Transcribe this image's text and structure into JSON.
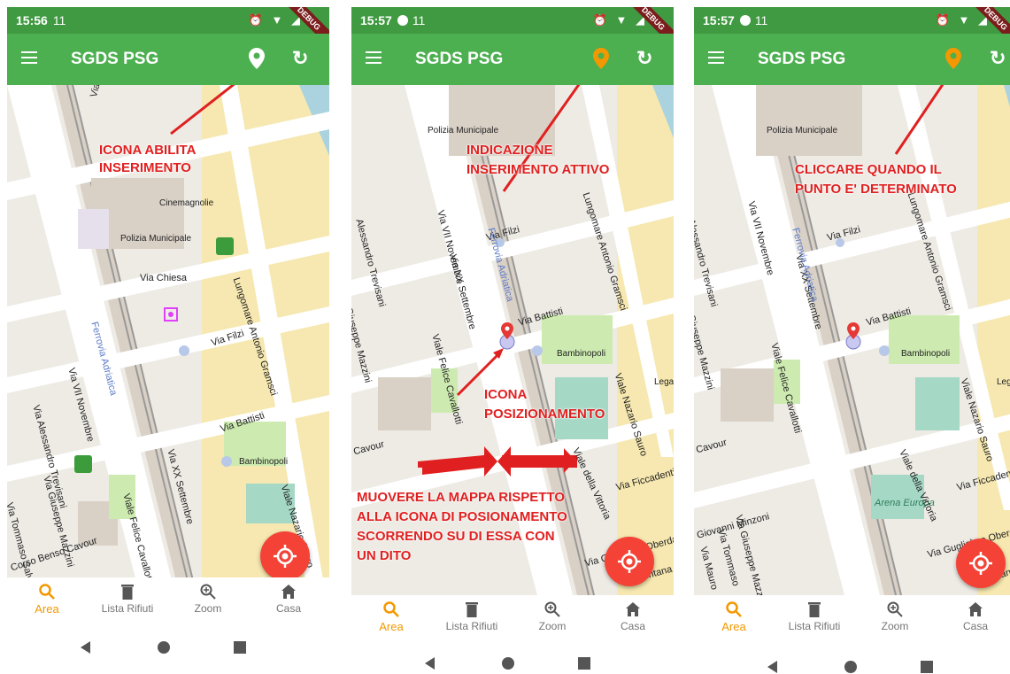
{
  "colors": {
    "appbar": "#4caf50",
    "statusbar": "#3f9a41",
    "accent_orange": "#f39800",
    "fab_red": "#f44336",
    "annotation_red": "#e02020"
  },
  "app": {
    "title": "SGDS PSG",
    "debug_badge": "DEBUG"
  },
  "nav": [
    {
      "label": "Area",
      "icon": "search-icon"
    },
    {
      "label": "Lista Rifiuti",
      "icon": "trash-icon"
    },
    {
      "label": "Zoom",
      "icon": "zoom-icon"
    },
    {
      "label": "Casa",
      "icon": "home-icon"
    }
  ],
  "screens": [
    {
      "status": {
        "time": "15:56",
        "indicators": "11",
        "icons": "⏰ ▼ ◢"
      },
      "pin_state": "white",
      "map_labels": [
        "Viale Vittorio Veneto",
        "Via Chiesa",
        "Via Filzi",
        "Via Battisti",
        "Polizia Municipale",
        "Cinemagnolie",
        "Bambinopoli",
        "Viale Felice Cavallotti",
        "Via XX Settembre",
        "Lungomare Antonio Gramsci",
        "Via VII Novembre",
        "Via Alessandro Trevisani",
        "Via Giuseppe Mazzini",
        "Via Tommaso Salvadori",
        "Viale Nazario Sauro",
        "Ferrovia Adriatica",
        "Corso Benso Cavour"
      ],
      "annotations": [
        "ICONA ABILITA",
        "INSERIMENTO"
      ]
    },
    {
      "status": {
        "time": "15:57",
        "indicators": "11",
        "icons": "⏰ ▼ ◢"
      },
      "pin_state": "orange",
      "map_labels": [
        "Polizia Municipale",
        "Via Filzi",
        "Via Battisti",
        "Bambinopoli",
        "Via XX Settembre",
        "Viale Felice Cavallotti",
        "Lungomare Antonio Gramsci",
        "Via VII Novembre",
        "Alessandro Trevisani",
        "Giuseppe Mazzini",
        "Cavour",
        "Viale della Vittoria",
        "Viale Nazario Sauro",
        "Via Ficcadenti",
        "Via Guglielmo Oberdan",
        "Ferrovia Adriatica",
        "Lega",
        "Mentana"
      ],
      "annotations": [
        "INDICAZIONE",
        "INSERIMENTO ATTIVO",
        "ICONA",
        "POSIZIONAMENTO",
        "MUOVERE LA MAPPA RISPETTO",
        "ALLA ICONA DI POSIONAMENTO",
        "SCORRENDO SU DI ESSA CON",
        "UN DITO"
      ]
    },
    {
      "status": {
        "time": "15:57",
        "indicators": "11",
        "icons": "⏰ ▼ ◢"
      },
      "pin_state": "orange",
      "map_labels": [
        "Polizia Municipale",
        "Via Filzi",
        "Via Battisti",
        "Bambinopoli",
        "Via XX Settembre",
        "Viale Felice Cavallotti",
        "Lungomare Antonio Gramsci",
        "Via VII Novembre",
        "Alessandro Trevisani",
        "Giuseppe Mazzini",
        "Cavour",
        "Viale della Vittoria",
        "Viale Nazario Sauro",
        "Via Ficcadenti",
        "Via Guglielmo Oberdan",
        "Arena Europa",
        "Giovanni Minzoni",
        "Via Giuseppe Mazzini",
        "Via Tommaso",
        "Via Mauro",
        "Ferrovia Adriatica",
        "Lega",
        "Mentana"
      ],
      "annotations": [
        "CLICCARE QUANDO IL",
        "PUNTO E' DETERMINATO"
      ]
    }
  ]
}
